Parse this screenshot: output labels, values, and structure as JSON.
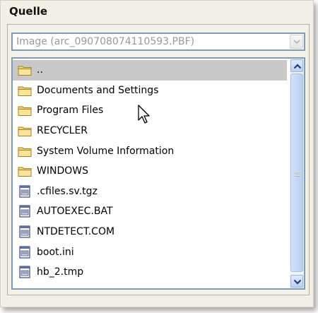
{
  "section": {
    "title": "Quelle"
  },
  "source_select": {
    "value": "Image (arc_090708074110593.PBF)"
  },
  "file_list": {
    "items": [
      {
        "label": "..",
        "type": "folder",
        "selected": true
      },
      {
        "label": "Documents and Settings",
        "type": "folder"
      },
      {
        "label": "Program Files",
        "type": "folder"
      },
      {
        "label": "RECYCLER",
        "type": "folder"
      },
      {
        "label": "System Volume Information",
        "type": "folder"
      },
      {
        "label": "WINDOWS",
        "type": "folder"
      },
      {
        "label": ".cfiles.sv.tgz",
        "type": "file"
      },
      {
        "label": "AUTOEXEC.BAT",
        "type": "file"
      },
      {
        "label": "NTDETECT.COM",
        "type": "file"
      },
      {
        "label": "boot.ini",
        "type": "file"
      },
      {
        "label": "hb_2.tmp",
        "type": "file"
      }
    ]
  },
  "icons": {
    "folder": "folder-icon",
    "file": "file-icon",
    "dropdown": "chevron-down-icon",
    "scroll_up": "chevron-up-icon",
    "scroll_down": "chevron-down-icon",
    "cursor": "mouse-pointer-icon"
  },
  "colors": {
    "selection": "#c8c8c8",
    "border_accent": "#7f9db9",
    "scrollbar": "#c6d8f6",
    "panel": "#f2f0e6"
  }
}
